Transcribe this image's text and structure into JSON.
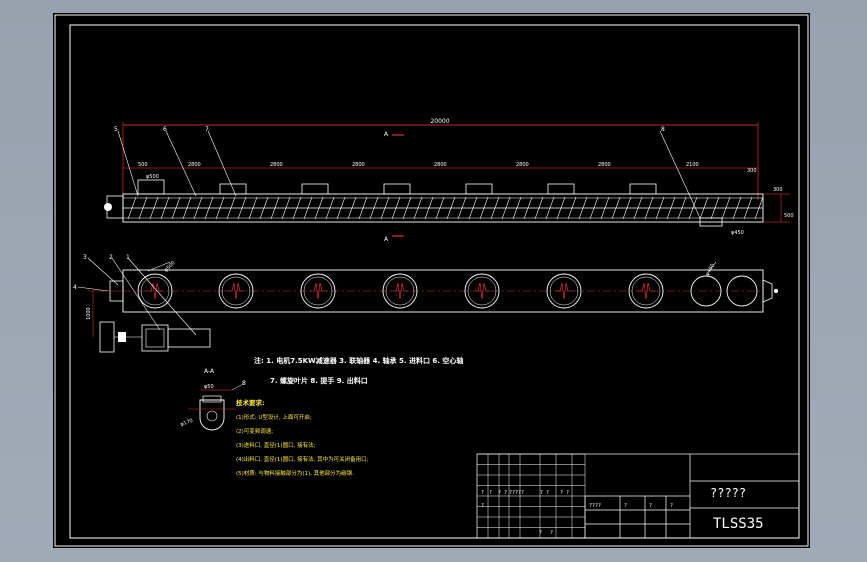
{
  "title_block": {
    "name": "?????",
    "code": "TLSS35",
    "small_marks": [
      "?",
      "?",
      "? ?",
      "?????",
      "? ?",
      "? ?",
      "?",
      "????",
      "?",
      "?",
      "?",
      "?",
      "?"
    ]
  },
  "dims": {
    "total": "20000",
    "seg_a": "500",
    "seg_b": "2800",
    "seg_c": "2100",
    "seg_d": "300",
    "dia_inlet": "φ500",
    "dia_outlet": "φ450",
    "h_small": "100",
    "h_right": "300",
    "h_right2": "500",
    "dim_1000": "1000",
    "dim_side": "φ450",
    "view_top": "A",
    "view_bottom": "A",
    "section_title": "A-A",
    "section_dim": "φ50",
    "section_dia": "φ170"
  },
  "balloons": [
    "5",
    "6",
    "7",
    "8",
    "3",
    "2",
    "1",
    "4",
    "8"
  ],
  "notes": {
    "line1": "注: 1. 电机7.5KW减速器  3. 联轴器  4. 轴承   5. 进料口  6. 空心轴",
    "line2": "7. 螺旋叶片  8. 提手  9. 出料口"
  },
  "tech": {
    "title": "技术要求:",
    "items": [
      "(1)形式: U型设计, 上面可开启;",
      "(2)可变频调速;",
      "(3)进料口, 直径(1)圆口, 接有法;",
      "(4)出料口, 直径(1)圆口, 接有法, 其中为可关闭备用口;",
      "(5)材质: 与物料接触部分为(1), 其他部分为碳钢."
    ]
  }
}
